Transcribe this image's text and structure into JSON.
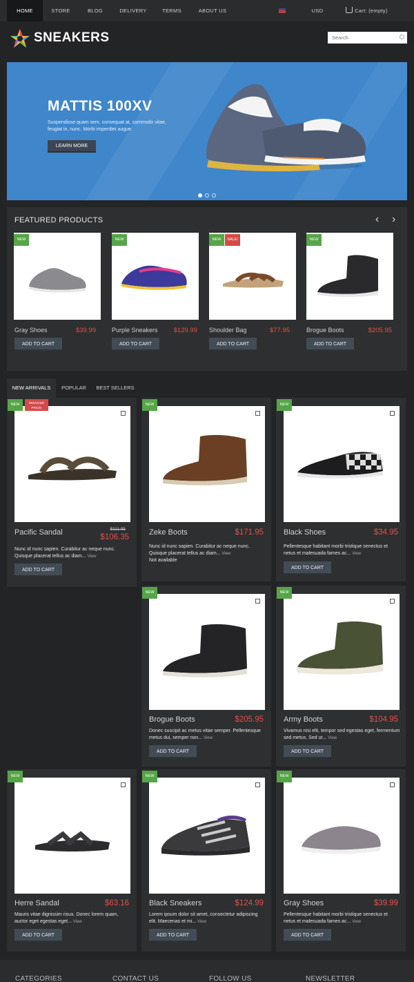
{
  "nav": {
    "items": [
      "HOME",
      "STORE",
      "BLOG",
      "DELIVERY",
      "TERMS",
      "ABOUT US"
    ],
    "currency": "USD",
    "cart": "Cart: (empty)"
  },
  "header": {
    "logo": "SNEAKERS",
    "search_placeholder": "Search"
  },
  "hero": {
    "title": "MATTIS 100XV",
    "description": "Suspendisse quam sem, consequat at, commodo vitae, feugiat in, nunc. Morbi imperdiet augue.",
    "button": "LEARN MORE"
  },
  "featured": {
    "title": "FEATURED PRODUCTS",
    "products": [
      {
        "name": "Gray Shoes",
        "price": "$39.99",
        "button": "ADD TO CART",
        "badges": [
          "NEW"
        ]
      },
      {
        "name": "Purple Sneakers",
        "price": "$129.99",
        "button": "ADD TO CART",
        "badges": [
          "NEW"
        ]
      },
      {
        "name": "Shoulder Bag",
        "price": "$77.95",
        "button": "ADD TO CART",
        "badges": [
          "NEW",
          "SALE!"
        ]
      },
      {
        "name": "Brogue Boots",
        "price": "$205.95",
        "button": "ADD TO CART",
        "badges": [
          "NEW"
        ]
      }
    ]
  },
  "tabs": [
    "NEW ARRIVALS",
    "POPULAR",
    "BEST SELLERS"
  ],
  "products": [
    {
      "name": "Pacific Sandal",
      "price": "$106.35",
      "old_price": "$111.95",
      "desc": "Nunc id nunc sapien. Curabitur ac neque nunc. Quisque placerat tellus ac diam...",
      "view": "View",
      "button": "ADD TO CART",
      "badge": "NEW",
      "reduced": "REDUCED PRICE!"
    },
    {
      "name": "Zeke Boots",
      "price": "$171.95",
      "desc": "Nunc id nunc sapien. Curabitur ac neque nunc. Quisque placerat tellus ac diam...",
      "view": "View",
      "availability": "Not available",
      "badge": "NEW"
    },
    {
      "name": "Black Shoes",
      "price": "$34.95",
      "desc": "Pellentesque habitant morbi tristique senectus et netus et malesuada fames ac...",
      "view": "View",
      "button": "ADD TO CART",
      "badge": "NEW"
    },
    {
      "name": "Brogue Boots",
      "price": "$205.95",
      "desc": "Donec suscipit ac metus vitae semper. Pellentesque metus dui, semper non...",
      "view": "View",
      "button": "ADD TO CART",
      "badge": "NEW"
    },
    {
      "name": "Army Boots",
      "price": "$104.95",
      "desc": "Vivamus nisi elit, tempor sed egestas eget, fermentum sed metus. Sed ut...",
      "view": "View",
      "button": "ADD TO CART",
      "badge": "NEW"
    },
    {
      "name": "Herre Sandal",
      "price": "$63.16",
      "desc": "Mauris vitae dignissim risus. Donec lorem quam, auctor eget egestas eget...",
      "view": "View",
      "button": "ADD TO CART",
      "badge": "NEW"
    },
    {
      "name": "Black Sneakers",
      "price": "$124.99",
      "desc": "Lorem ipsum dolor sit amet, consectetur adipiscing elit. Maecenas et mi...",
      "view": "View",
      "button": "ADD TO CART",
      "badge": "NEW"
    },
    {
      "name": "Gray Shoes",
      "price": "$39.99",
      "desc": "Pellentesque habitant morbi tristique senectus et netus et malesuada fames ac...",
      "view": "View",
      "button": "ADD TO CART",
      "badge": "NEW"
    }
  ],
  "footer": {
    "columns": [
      "CATEGORIES",
      "CONTACT US",
      "FOLLOW US",
      "NEWSLETTER"
    ]
  },
  "colors": {
    "background": "#232426",
    "panel": "#2d2f31",
    "hero_blue": "#3f86cb",
    "price_red": "#e0514a",
    "badge_green": "#56a548",
    "badge_red": "#d64a4a",
    "button": "#434b55"
  }
}
